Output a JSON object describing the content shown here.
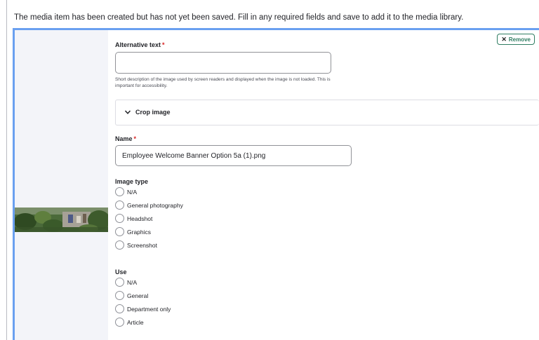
{
  "message": "The media item has been created but has not yet been saved. Fill in any required fields and save to add it to the media library.",
  "remove_button": {
    "label": "Remove",
    "icon": "close-icon"
  },
  "alt_text": {
    "label": "Alternative text",
    "required_marker": "*",
    "value": "",
    "description": "Short description of the image used by screen readers and displayed when the image is not loaded. This is important for accessibility."
  },
  "crop": {
    "label": "Crop image",
    "icon": "chevron-down-icon"
  },
  "name": {
    "label": "Name",
    "required_marker": "*",
    "value": "Employee Welcome Banner Option 5a (1).png"
  },
  "image_type": {
    "label": "Image type",
    "options": [
      "N/A",
      "General photography",
      "Headshot",
      "Graphics",
      "Screenshot"
    ]
  },
  "use": {
    "label": "Use",
    "options": [
      "N/A",
      "General",
      "Department only",
      "Article"
    ]
  },
  "colors": {
    "accent_border": "#6aa0f0",
    "remove_green": "#2f7d62",
    "required": "#d72222"
  }
}
